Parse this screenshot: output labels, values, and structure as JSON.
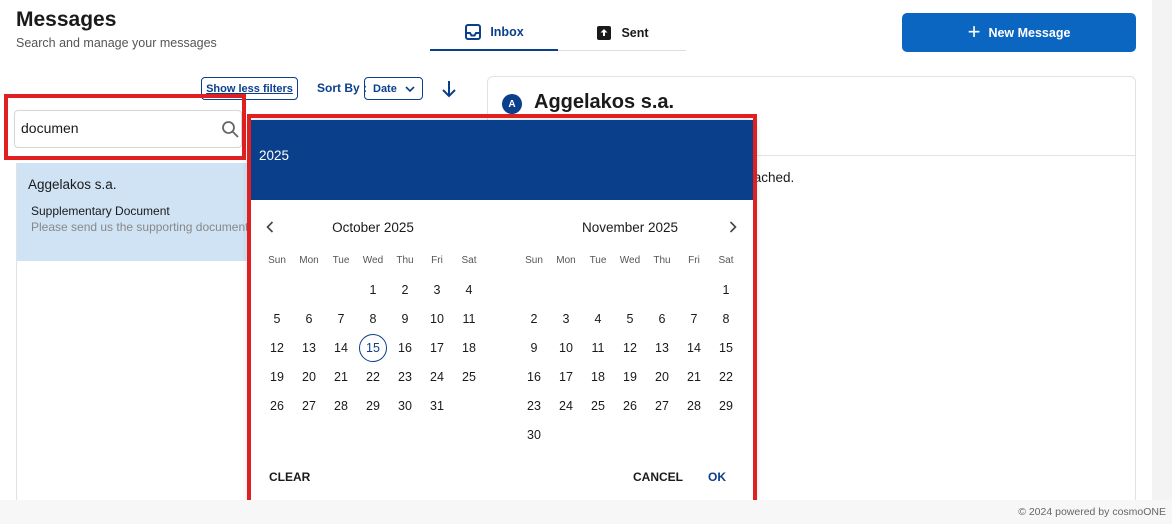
{
  "header": {
    "title": "Messages",
    "subtitle": "Search and manage your messages",
    "new_message_label": "New Message"
  },
  "tabs": [
    {
      "label": "Inbox",
      "icon": "inbox-icon",
      "active": true
    },
    {
      "label": "Sent",
      "icon": "sent-icon",
      "active": false
    }
  ],
  "filters": {
    "show_less_label": "Show less filters",
    "sort_by_label": "Sort By :",
    "sort_value": "Date",
    "sort_direction": "descending"
  },
  "search": {
    "value": "documen"
  },
  "messages": [
    {
      "company": "Aggelakos s.a.",
      "subject": "Supplementary Document",
      "preview": "Please send us the supporting document a",
      "selected": true
    }
  ],
  "detail": {
    "avatar_letter": "A",
    "company": "Aggelakos s.a.",
    "body_visible": "tached."
  },
  "datepicker": {
    "year": "2025",
    "months": [
      {
        "title": "October 2025",
        "weekdays": [
          "Sun",
          "Mon",
          "Tue",
          "Wed",
          "Thu",
          "Fri",
          "Sat"
        ],
        "first_weekday": 3,
        "days_in_month": 31,
        "today": 15
      },
      {
        "title": "November 2025",
        "weekdays": [
          "Sun",
          "Mon",
          "Tue",
          "Wed",
          "Thu",
          "Fri",
          "Sat"
        ],
        "first_weekday": 6,
        "days_in_month": 30,
        "today": null
      }
    ],
    "clear_label": "CLEAR",
    "cancel_label": "CANCEL",
    "ok_label": "OK"
  },
  "footer": {
    "text": "© 2024 powered by cosmoONE"
  },
  "colors": {
    "primary": "#0a3f8c",
    "button_blue": "#0b66c2",
    "selected_row": "#cfe3f5",
    "highlight_red": "#e02020"
  }
}
